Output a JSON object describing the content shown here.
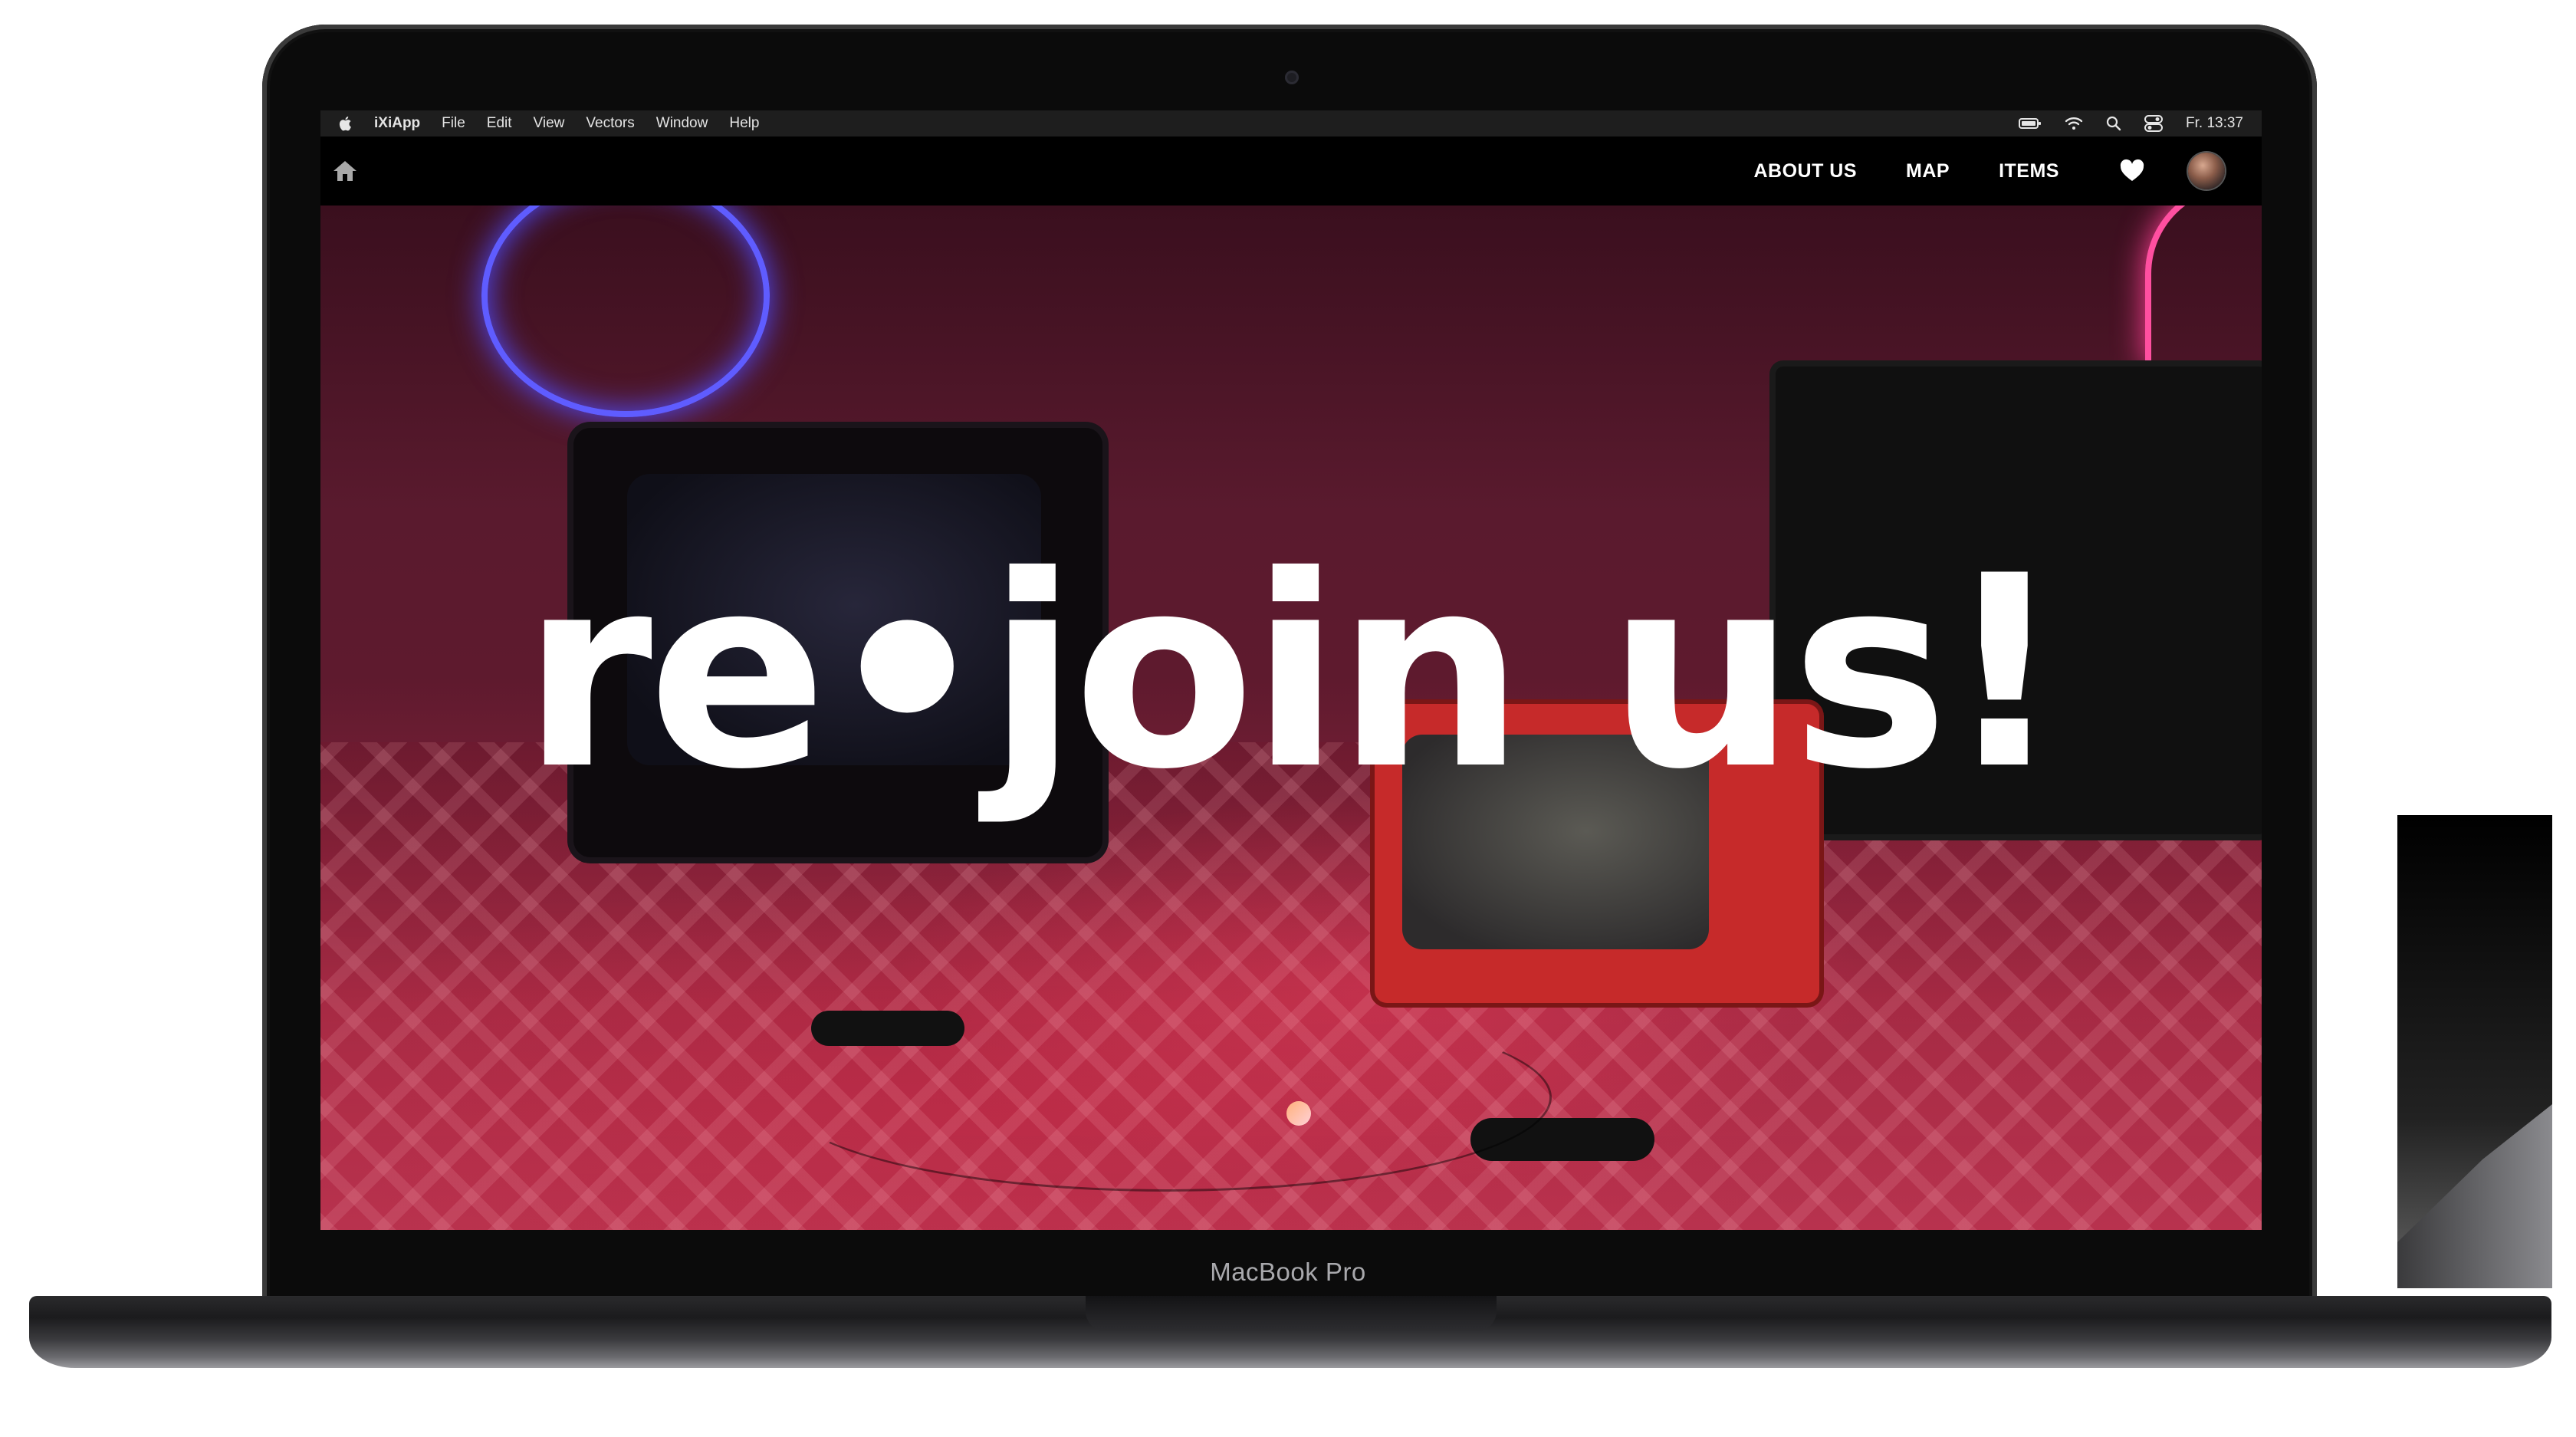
{
  "device": {
    "label": "MacBook Pro"
  },
  "menubar": {
    "items": [
      "iXiApp",
      "File",
      "Edit",
      "View",
      "Vectors",
      "Window",
      "Help"
    ],
    "clock": "Fr. 13:37",
    "icons": [
      "apple-icon",
      "battery-icon",
      "wifi-icon",
      "spotlight-icon",
      "control-center-icon"
    ]
  },
  "navbar": {
    "home_icon": "home-icon",
    "links": [
      "ABOUT US",
      "MAP",
      "ITEMS"
    ],
    "heart_icon": "heart-icon",
    "avatar": "user-avatar"
  },
  "hero": {
    "headline": "re•join us!",
    "scroll_indicator": "scroll-dot",
    "corner_icon": "bolt-icon"
  },
  "colors": {
    "menubar_bg": "#1e1e1e",
    "navbar_bg": "#000000",
    "headline": "#ffffff",
    "hero_tint": "#7a1f36"
  }
}
